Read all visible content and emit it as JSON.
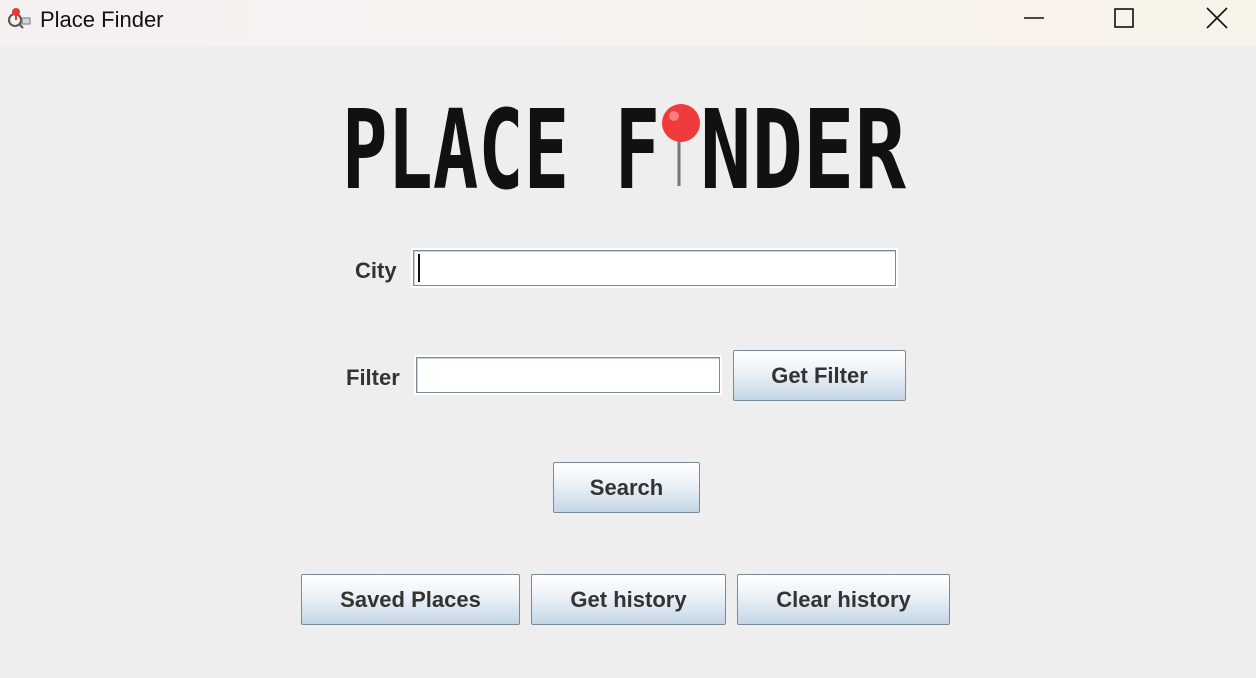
{
  "window": {
    "title": "Place Finder",
    "app_icon": "pin-magnifier-icon"
  },
  "window_controls": {
    "minimize_icon": "minimize-icon",
    "maximize_icon": "maximize-icon",
    "close_icon": "close-icon"
  },
  "logo": {
    "text_left": "PLACE F",
    "text_right": "NDER",
    "pin_color": "#ef3b3b"
  },
  "form": {
    "city_label": "City",
    "city_value": "",
    "filter_label": "Filter",
    "filter_value": "",
    "get_filter_label": "Get Filter",
    "search_label": "Search"
  },
  "actions": {
    "saved_places_label": "Saved Places",
    "get_history_label": "Get history",
    "clear_history_label": "Clear history"
  },
  "colors": {
    "background": "#eeeeee",
    "button_border": "#7a8a99",
    "label_text": "#333333"
  }
}
